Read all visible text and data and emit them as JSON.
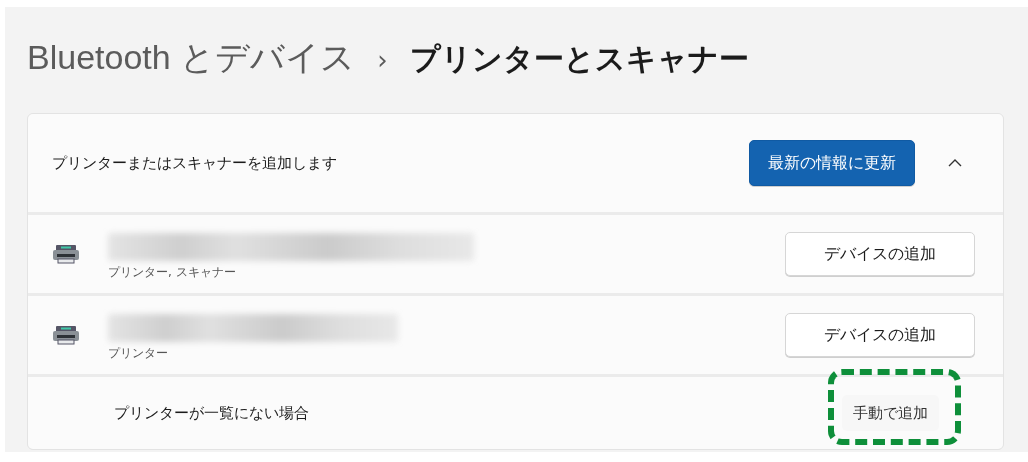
{
  "breadcrumb": {
    "parent": "Bluetooth とデバイス",
    "separator": "›",
    "current": "プリンターとスキャナー"
  },
  "add_section": {
    "title": "プリンターまたはスキャナーを追加します",
    "refresh_button": "最新の情報に更新",
    "expanded": true,
    "devices": [
      {
        "kind": "printer",
        "subtitle": "プリンター, スキャナー",
        "button": "デバイスの追加"
      },
      {
        "kind": "printer",
        "subtitle": "プリンター",
        "button": "デバイスの追加"
      }
    ],
    "not_listed": {
      "label": "プリンターが一覧にない場合",
      "button": "手動で追加",
      "highlighted": true
    }
  }
}
